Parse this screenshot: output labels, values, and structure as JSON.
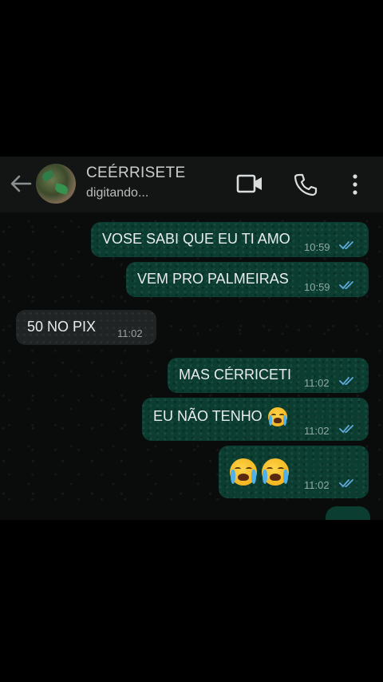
{
  "header": {
    "contact_name": "CEÉRRISETE",
    "status": "digitando..."
  },
  "icons": {
    "back": "back-arrow-icon",
    "video": "video-call-icon",
    "call": "phone-call-icon",
    "menu": "more-options-icon"
  },
  "colors": {
    "outgoing_bubble": "#0b3d31",
    "incoming_bubble": "#202425",
    "read_ticks": "#5ea9d8"
  },
  "messages": [
    {
      "direction": "out",
      "text": "VOSE SABI QUE EU TI AMO",
      "time": "10:59",
      "read": true
    },
    {
      "direction": "out",
      "text": "VEM PRO PALMEIRAS",
      "time": "10:59",
      "read": true
    },
    {
      "direction": "in",
      "text": "50 NO PIX",
      "time": "11:02"
    },
    {
      "direction": "out",
      "text": "MAS CÉRRICETI",
      "time": "11:02",
      "read": true
    },
    {
      "direction": "out",
      "text": "EU NÃO TENHO",
      "time": "11:02",
      "read": true,
      "emoji": "crying-face"
    },
    {
      "direction": "out",
      "text": "",
      "time": "11:02",
      "read": true,
      "emoji": "crying-face crying-face"
    }
  ]
}
